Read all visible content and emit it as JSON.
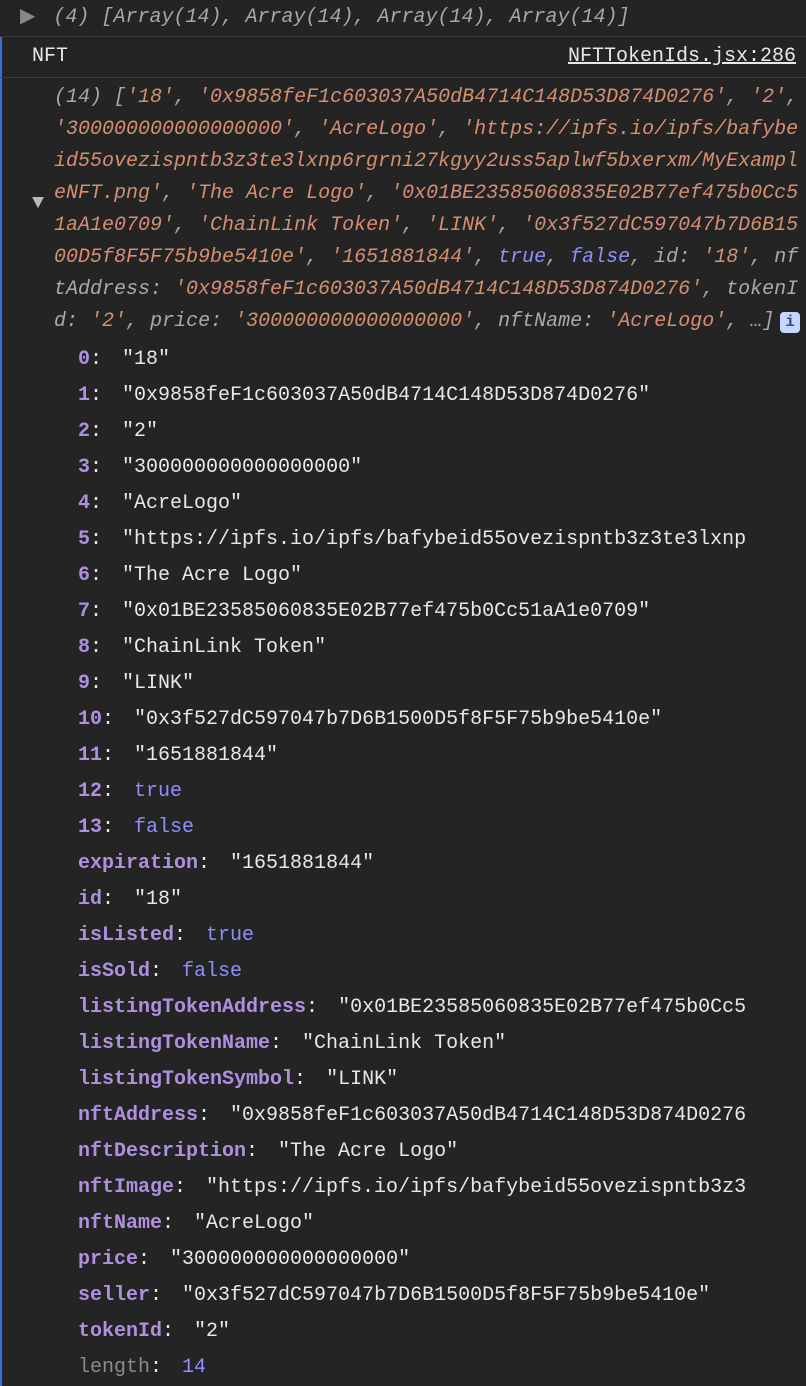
{
  "topRow": {
    "count": "(4)",
    "items": "[Array(14), Array(14), Array(14), Array(14)]"
  },
  "header": {
    "label": "NFT",
    "source": "NFTTokenIds.jsx:286"
  },
  "summary": {
    "count": "(14)",
    "positional": [
      "'18'",
      "'0x9858feF1c603037A50dB4714C148D53D874D0276'",
      "'2'",
      "'300000000000000000'",
      "'AcreLogo'",
      "'https://ipfs.io/ipfs/bafybeid55ovezispntb3z3te3lxnp6rgrni27kgyy2uss5aplwf5bxerxm/MyExampleNFT.png'",
      "'The Acre Logo'",
      "'0x01BE23585060835E02B77ef475b0Cc51aA1e0709'",
      "'ChainLink Token'",
      "'LINK'",
      "'0x3f527dC597047b7D6B1500D5f8F5F75b9be5410e'",
      "'1651881844'",
      "true",
      "false"
    ],
    "namedPreview": [
      {
        "k": "id",
        "v": "'18'"
      },
      {
        "k": "nftAddress",
        "v": "'0x9858feF1c603037A50dB4714C148D53D874D0276'"
      },
      {
        "k": "tokenId",
        "v": "'2'"
      },
      {
        "k": "price",
        "v": "'300000000000000000'"
      },
      {
        "k": "nftName",
        "v": "'AcreLogo'"
      }
    ],
    "ellipsis": "…"
  },
  "properties": [
    {
      "key": "0",
      "type": "str",
      "val": "\"18\""
    },
    {
      "key": "1",
      "type": "str",
      "val": "\"0x9858feF1c603037A50dB4714C148D53D874D0276\""
    },
    {
      "key": "2",
      "type": "str",
      "val": "\"2\""
    },
    {
      "key": "3",
      "type": "str",
      "val": "\"300000000000000000\""
    },
    {
      "key": "4",
      "type": "str",
      "val": "\"AcreLogo\""
    },
    {
      "key": "5",
      "type": "str",
      "val": "\"https://ipfs.io/ipfs/bafybeid55ovezispntb3z3te3lxnp"
    },
    {
      "key": "6",
      "type": "str",
      "val": "\"The Acre Logo\""
    },
    {
      "key": "7",
      "type": "str",
      "val": "\"0x01BE23585060835E02B77ef475b0Cc51aA1e0709\""
    },
    {
      "key": "8",
      "type": "str",
      "val": "\"ChainLink Token\""
    },
    {
      "key": "9",
      "type": "str",
      "val": "\"LINK\""
    },
    {
      "key": "10",
      "type": "str",
      "val": "\"0x3f527dC597047b7D6B1500D5f8F5F75b9be5410e\""
    },
    {
      "key": "11",
      "type": "str",
      "val": "\"1651881844\""
    },
    {
      "key": "12",
      "type": "bool",
      "val": "true"
    },
    {
      "key": "13",
      "type": "bool",
      "val": "false"
    },
    {
      "key": "expiration",
      "type": "str",
      "val": "\"1651881844\""
    },
    {
      "key": "id",
      "type": "str",
      "val": "\"18\""
    },
    {
      "key": "isListed",
      "type": "bool",
      "val": "true"
    },
    {
      "key": "isSold",
      "type": "bool",
      "val": "false"
    },
    {
      "key": "listingTokenAddress",
      "type": "str",
      "val": "\"0x01BE23585060835E02B77ef475b0Cc5"
    },
    {
      "key": "listingTokenName",
      "type": "str",
      "val": "\"ChainLink Token\""
    },
    {
      "key": "listingTokenSymbol",
      "type": "str",
      "val": "\"LINK\""
    },
    {
      "key": "nftAddress",
      "type": "str",
      "val": "\"0x9858feF1c603037A50dB4714C148D53D874D0276"
    },
    {
      "key": "nftDescription",
      "type": "str",
      "val": "\"The Acre Logo\""
    },
    {
      "key": "nftImage",
      "type": "str",
      "val": "\"https://ipfs.io/ipfs/bafybeid55ovezispntb3z3"
    },
    {
      "key": "nftName",
      "type": "str",
      "val": "\"AcreLogo\""
    },
    {
      "key": "price",
      "type": "str",
      "val": "\"300000000000000000\""
    },
    {
      "key": "seller",
      "type": "str",
      "val": "\"0x3f527dC597047b7D6B1500D5f8F5F75b9be5410e\""
    },
    {
      "key": "tokenId",
      "type": "str",
      "val": "\"2\""
    },
    {
      "key": "length",
      "type": "num",
      "val": "14",
      "dim": true
    }
  ],
  "glyphs": {
    "rightArrow": "▶",
    "downArrow": "▼",
    "info": "i"
  }
}
